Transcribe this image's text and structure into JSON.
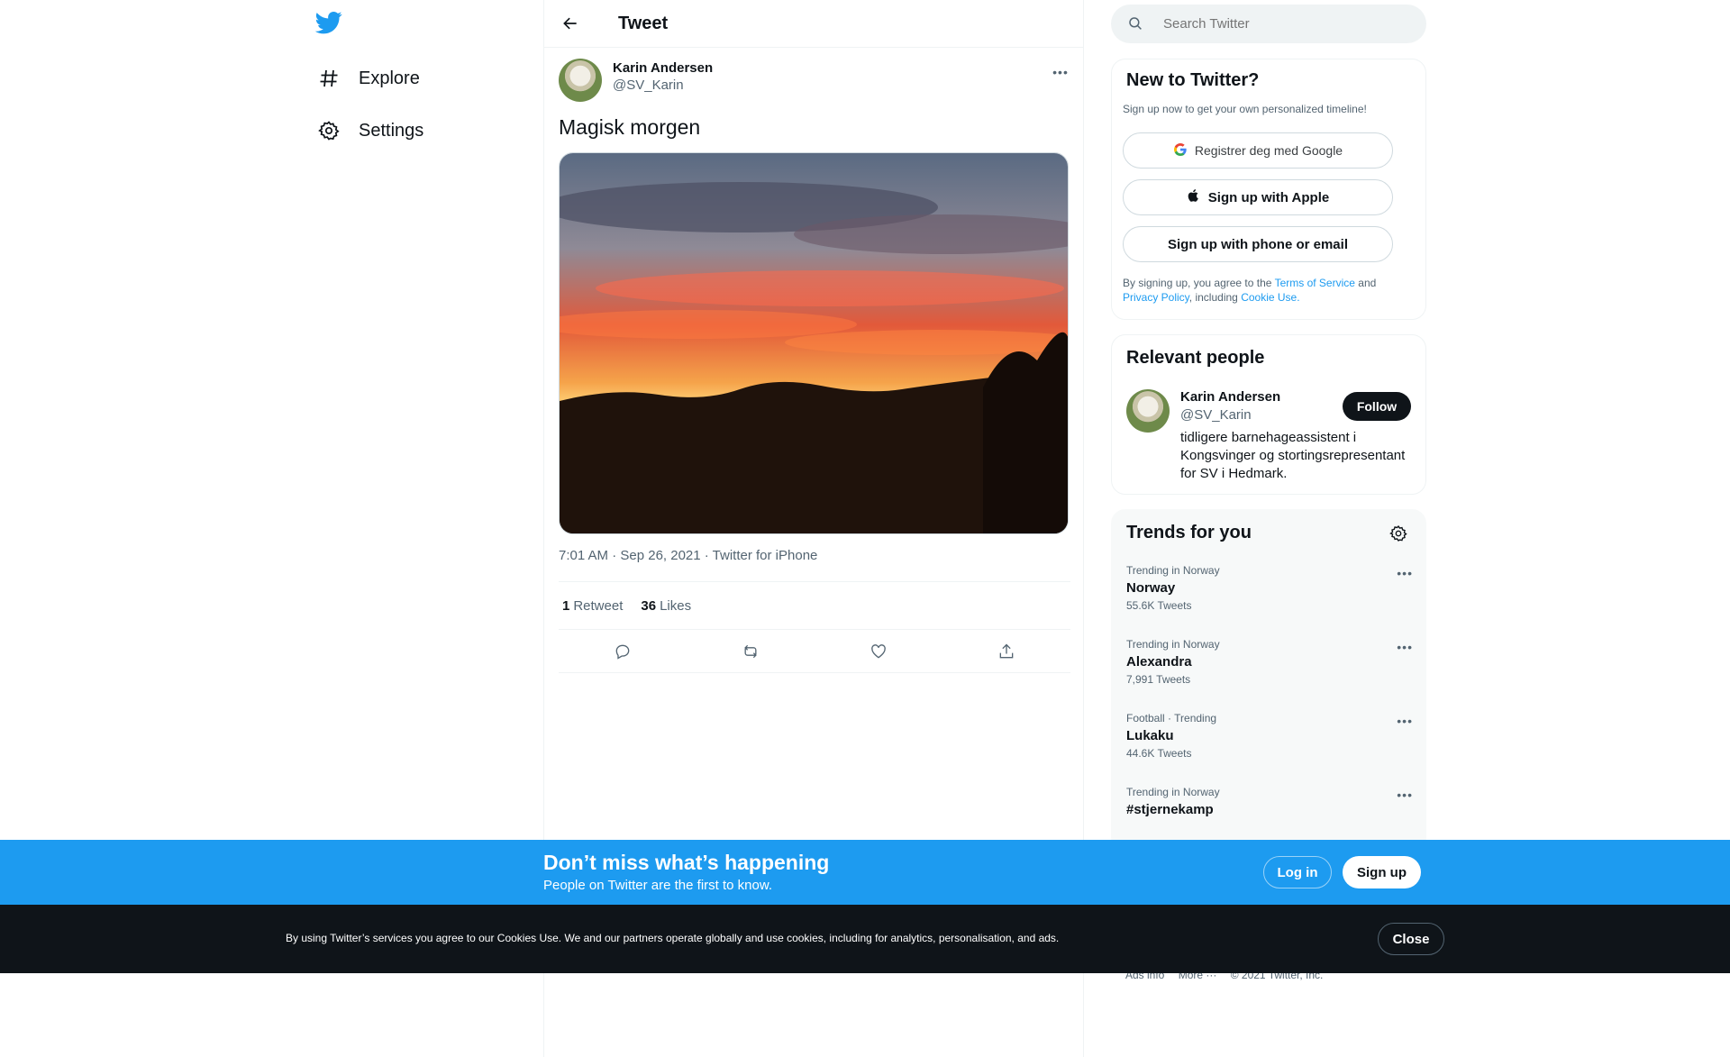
{
  "nav": {
    "items": [
      {
        "label": "Explore",
        "icon": "hashtag-icon"
      },
      {
        "label": "Settings",
        "icon": "gear-icon"
      }
    ]
  },
  "header": {
    "title": "Tweet"
  },
  "tweet": {
    "author_name": "Karin Andersen",
    "author_handle": "@SV_Karin",
    "text": "Magisk morgen",
    "time": "7:01 AM · Sep 26, 2021 · Twitter for iPhone",
    "retweets": "1",
    "retweets_label": "Retweet",
    "likes": "36",
    "likes_label": "Likes"
  },
  "search": {
    "placeholder": "Search Twitter"
  },
  "signup_card": {
    "title": "New to Twitter?",
    "subtitle": "Sign up now to get your own personalized timeline!",
    "google": "Registrer deg med Google",
    "apple": "Sign up with Apple",
    "phone": "Sign up with phone or email",
    "legal_prefix": "By signing up, you agree to the",
    "terms": "Terms of Service",
    "and": "and",
    "privacy": "Privacy Policy",
    "including": ", including",
    "cookie": "Cookie Use."
  },
  "people": {
    "title": "Relevant people",
    "name": "Karin Andersen",
    "handle": "@SV_Karin",
    "bio": "tidligere barnehageassistent i Kongsvinger og stortingsrepresentant for SV i Hedmark.",
    "follow": "Follow"
  },
  "trends": {
    "title": "Trends for you",
    "items": [
      {
        "context": "Trending in Norway",
        "name": "Norway",
        "count": "55.6K Tweets"
      },
      {
        "context": "Trending in Norway",
        "name": "Alexandra",
        "count": "7,991 Tweets"
      },
      {
        "context": "Football · Trending",
        "name": "Lukaku",
        "count": "44.6K Tweets"
      },
      {
        "context": "Trending in Norway",
        "name": "#stjernekamp",
        "count": ""
      }
    ]
  },
  "footer": {
    "ads": "Ads info",
    "more": "More ···",
    "copyright": "© 2021 Twitter, Inc."
  },
  "banner": {
    "headline": "Don’t miss what’s happening",
    "sub": "People on Twitter are the first to know.",
    "login": "Log in",
    "signup": "Sign up"
  },
  "cookie_bar": {
    "text": "By using Twitter’s services you agree to our Cookies Use. We and our partners operate globally and use cookies, including for analytics, personalisation, and ads.",
    "close": "Close"
  },
  "colors": {
    "brand": "#1d9bf0",
    "text": "#0f1419",
    "muted": "#536471"
  }
}
